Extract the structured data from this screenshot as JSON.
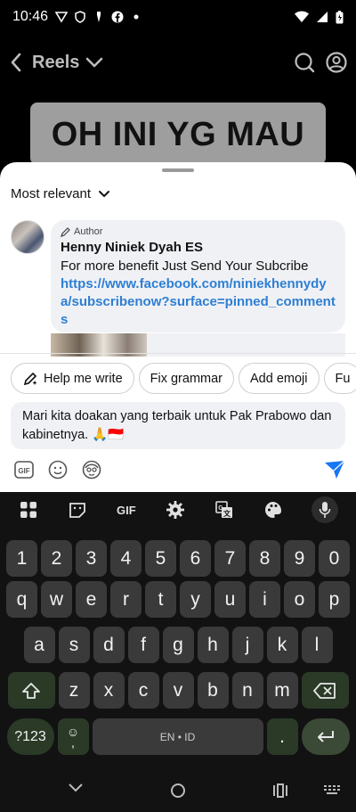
{
  "status_bar": {
    "time": "10:46"
  },
  "header": {
    "title": "Reels"
  },
  "video": {
    "caption": "OH INI YG MAU"
  },
  "sheet": {
    "sort_label": "Most relevant",
    "comment": {
      "author_tag": "Author",
      "name": "Henny Niniek Dyah ES",
      "text": "For more benefit Just Send Your Subcribe",
      "link": "https://www.facebook.com/niniekhennydya/subscribenow?surface=pinned_comments"
    },
    "chips": [
      "Help me write",
      "Fix grammar",
      "Add emoji",
      "Fu"
    ],
    "input_value": "Mari kita doakan yang terbaik untuk Pak Prabowo dan kabinetnya. 🙏🇮🇩"
  },
  "keyboard": {
    "toolbar_gif": "GIF",
    "row_numbers": [
      "1",
      "2",
      "3",
      "4",
      "5",
      "6",
      "7",
      "8",
      "9",
      "0"
    ],
    "row1": [
      "q",
      "w",
      "e",
      "r",
      "t",
      "y",
      "u",
      "i",
      "o",
      "p"
    ],
    "row2": [
      "a",
      "s",
      "d",
      "f",
      "g",
      "h",
      "j",
      "k",
      "l"
    ],
    "row3": [
      "z",
      "x",
      "c",
      "v",
      "b",
      "n",
      "m"
    ],
    "symbols_key": "?123",
    "space_label": "EN • ID",
    "period_key": "."
  }
}
